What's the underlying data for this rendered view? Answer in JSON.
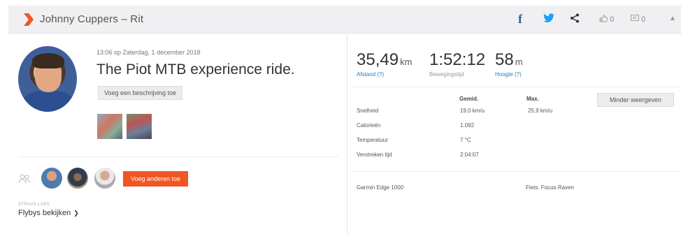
{
  "header": {
    "title": "Johnny Cuppers – Rit",
    "brand_icon": "strava-chevron-icon",
    "kudos_count": "0",
    "comments_count": "0",
    "colors": {
      "background": "#f0f0f2",
      "brand": "#f05522",
      "facebook": "#3b5998",
      "twitter": "#1da1f2"
    }
  },
  "activity": {
    "datetime": "13:06 op Zaterdag, 1 december 2018",
    "title": "The Piot MTB experience ride.",
    "add_description_label": "Voeg een beschrijving toe"
  },
  "group": {
    "add_others_label": "Voeg anderen toe",
    "strava_labs": "STRAVA LABS",
    "flybys_label": "Flybys bekijken"
  },
  "stats": {
    "distance": {
      "value": "35,49",
      "unit": "km",
      "label": "Afstand (?)"
    },
    "moving_time": {
      "value": "1:52:12",
      "label": "Bewegingstijd"
    },
    "elevation": {
      "value": "58",
      "unit": "m",
      "label": "Hoogte (?)"
    }
  },
  "details": {
    "less_button_label": "Minder weergeven",
    "columns": [
      "Gemid.",
      "Max."
    ],
    "rows": [
      {
        "label": "Snelheid",
        "avg": "19,0 km/u",
        "max": "25,9 km/u"
      },
      {
        "label": "Calorieën",
        "avg": "1.092",
        "max": ""
      },
      {
        "label": "Temperatuur",
        "avg": "7 °C",
        "max": ""
      },
      {
        "label": "Verstreken tijd",
        "avg": "2:04:07",
        "max": ""
      }
    ],
    "device": "Garmin Edge 1000",
    "bike": "Fiets: Focus Raven"
  }
}
